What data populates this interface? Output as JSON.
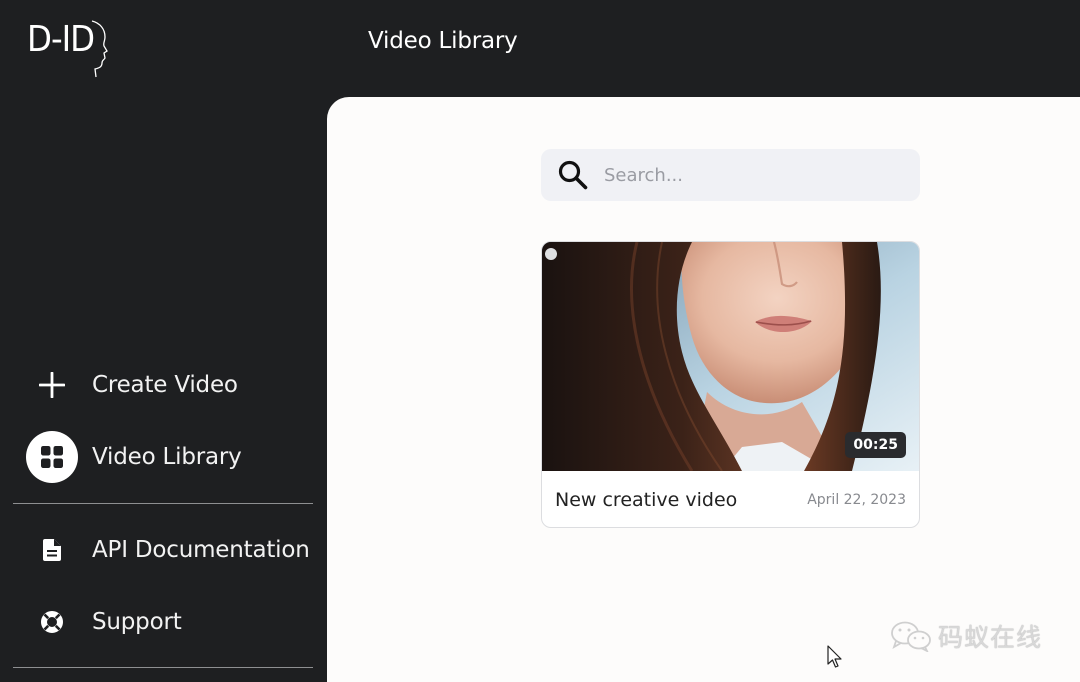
{
  "app": {
    "logo_text": "D-ID",
    "page_title": "Video Library"
  },
  "sidebar": {
    "items": [
      {
        "id": "create",
        "label": "Create Video",
        "icon": "plus-icon",
        "active": false
      },
      {
        "id": "library",
        "label": "Video Library",
        "icon": "grid-icon",
        "active": true
      },
      {
        "id": "api",
        "label": "API Documentation",
        "icon": "document-icon",
        "active": false
      },
      {
        "id": "support",
        "label": "Support",
        "icon": "lifebuoy-icon",
        "active": false
      }
    ]
  },
  "search": {
    "placeholder": "Search...",
    "value": ""
  },
  "videos": [
    {
      "title": "New creative video",
      "date": "April 22, 2023",
      "duration": "00:25"
    }
  ],
  "watermark": {
    "text": "码蚁在线"
  },
  "colors": {
    "sidebar_bg": "#1e1f21",
    "main_bg": "#fdfcfb",
    "search_bg": "#f0f1f5",
    "active_icon_bg": "#ffffff"
  }
}
